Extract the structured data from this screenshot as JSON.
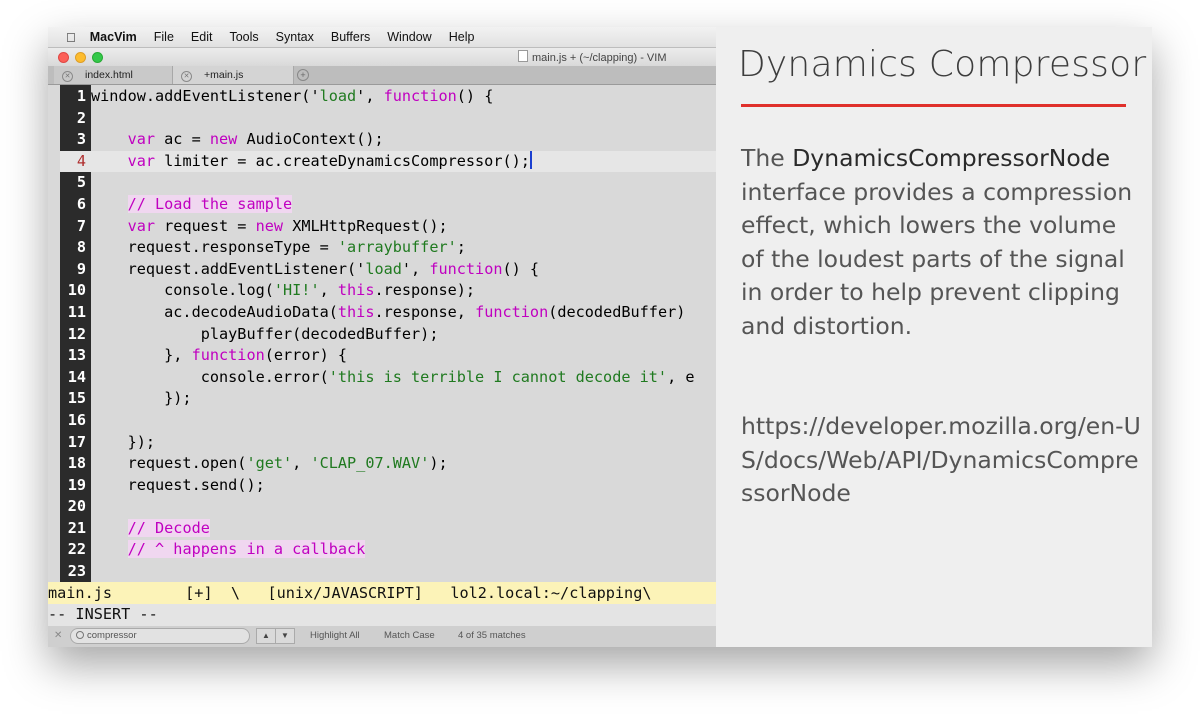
{
  "menubar": {
    "app": "MacVim",
    "items": [
      "File",
      "Edit",
      "Tools",
      "Syntax",
      "Buffers",
      "Window",
      "Help"
    ]
  },
  "window": {
    "title": "main.js + (~/clapping) - VIM"
  },
  "tabs": [
    {
      "label": "index.html"
    },
    {
      "label": "+main.js"
    }
  ],
  "editor": {
    "current_line": 4,
    "lines": [
      {
        "n": "1",
        "parts": [
          [
            "t",
            "window.addEventListener('"
          ],
          [
            "s",
            "load"
          ],
          [
            "t",
            "', "
          ],
          [
            "k",
            "function"
          ],
          [
            "t",
            "() {"
          ]
        ]
      },
      {
        "n": "2",
        "parts": []
      },
      {
        "n": "3",
        "parts": [
          [
            "t",
            "    "
          ],
          [
            "k",
            "var"
          ],
          [
            "t",
            " ac = "
          ],
          [
            "k",
            "new"
          ],
          [
            "t",
            " AudioContext();"
          ]
        ]
      },
      {
        "n": "4",
        "parts": [
          [
            "t",
            "    "
          ],
          [
            "k",
            "var"
          ],
          [
            "t",
            " limiter = ac.createDynamicsCompressor();"
          ],
          [
            "cursor",
            ""
          ]
        ]
      },
      {
        "n": "5",
        "parts": []
      },
      {
        "n": "6",
        "parts": [
          [
            "t",
            "    "
          ],
          [
            "c",
            "// Load the sample"
          ]
        ]
      },
      {
        "n": "7",
        "parts": [
          [
            "t",
            "    "
          ],
          [
            "k",
            "var"
          ],
          [
            "t",
            " request = "
          ],
          [
            "k",
            "new"
          ],
          [
            "t",
            " XMLHttpRequest();"
          ]
        ]
      },
      {
        "n": "8",
        "parts": [
          [
            "t",
            "    request.responseType = "
          ],
          [
            "s",
            "'arraybuffer'"
          ],
          [
            "t",
            ";"
          ]
        ]
      },
      {
        "n": "9",
        "parts": [
          [
            "t",
            "    request.addEventListener('"
          ],
          [
            "s",
            "load"
          ],
          [
            "t",
            "', "
          ],
          [
            "k",
            "function"
          ],
          [
            "t",
            "() {"
          ]
        ]
      },
      {
        "n": "10",
        "parts": [
          [
            "t",
            "        console.log("
          ],
          [
            "s",
            "'HI!'"
          ],
          [
            "t",
            ", "
          ],
          [
            "k",
            "this"
          ],
          [
            "t",
            ".response);"
          ]
        ]
      },
      {
        "n": "11",
        "parts": [
          [
            "t",
            "        ac.decodeAudioData("
          ],
          [
            "k",
            "this"
          ],
          [
            "t",
            ".response, "
          ],
          [
            "k",
            "function"
          ],
          [
            "t",
            "(decodedBuffer) "
          ]
        ]
      },
      {
        "n": "12",
        "parts": [
          [
            "t",
            "            playBuffer(decodedBuffer);"
          ]
        ]
      },
      {
        "n": "13",
        "parts": [
          [
            "t",
            "        }, "
          ],
          [
            "k",
            "function"
          ],
          [
            "t",
            "(error) {"
          ]
        ]
      },
      {
        "n": "14",
        "parts": [
          [
            "t",
            "            console.error("
          ],
          [
            "s",
            "'this is terrible I cannot decode it'"
          ],
          [
            "t",
            ", e"
          ]
        ]
      },
      {
        "n": "15",
        "parts": [
          [
            "t",
            "        });"
          ]
        ]
      },
      {
        "n": "16",
        "parts": []
      },
      {
        "n": "17",
        "parts": [
          [
            "t",
            "    });"
          ]
        ]
      },
      {
        "n": "18",
        "parts": [
          [
            "t",
            "    request.open("
          ],
          [
            "s",
            "'get'"
          ],
          [
            "t",
            ", "
          ],
          [
            "s",
            "'CLAP_07.WAV'"
          ],
          [
            "t",
            ");"
          ]
        ]
      },
      {
        "n": "19",
        "parts": [
          [
            "t",
            "    request.send();"
          ]
        ]
      },
      {
        "n": "20",
        "parts": []
      },
      {
        "n": "21",
        "parts": [
          [
            "t",
            "    "
          ],
          [
            "c",
            "// Decode"
          ]
        ]
      },
      {
        "n": "22",
        "parts": [
          [
            "t",
            "    "
          ],
          [
            "c",
            "// ^ happens in a callback"
          ]
        ]
      },
      {
        "n": "23",
        "parts": []
      }
    ]
  },
  "statusline": {
    "text": "main.js        [+]  \\   [unix/JAVASCRIPT]   lol2.local:~/clapping\\"
  },
  "modeline": {
    "text": "-- INSERT --"
  },
  "findbar": {
    "query": "compressor",
    "highlight_all": "Highlight All",
    "match_case": "Match Case",
    "matches": "4 of 35 matches"
  },
  "panel": {
    "title": "Dynamics Compressor",
    "lead_word": "The ",
    "term": "DynamicsCompressorNode",
    "description": " interface provides a compression effect, which lowers the volume of the loudest parts of the signal in order to help prevent clipping and distortion.",
    "link": "https://developer.mozilla.org/en-US/docs/Web/API/DynamicsCompressorNode"
  },
  "colors": {
    "accent_rule": "#e0302b",
    "keyword": "#c000c0",
    "string": "#207a20",
    "statusline_bg": "#fcf3b8"
  }
}
